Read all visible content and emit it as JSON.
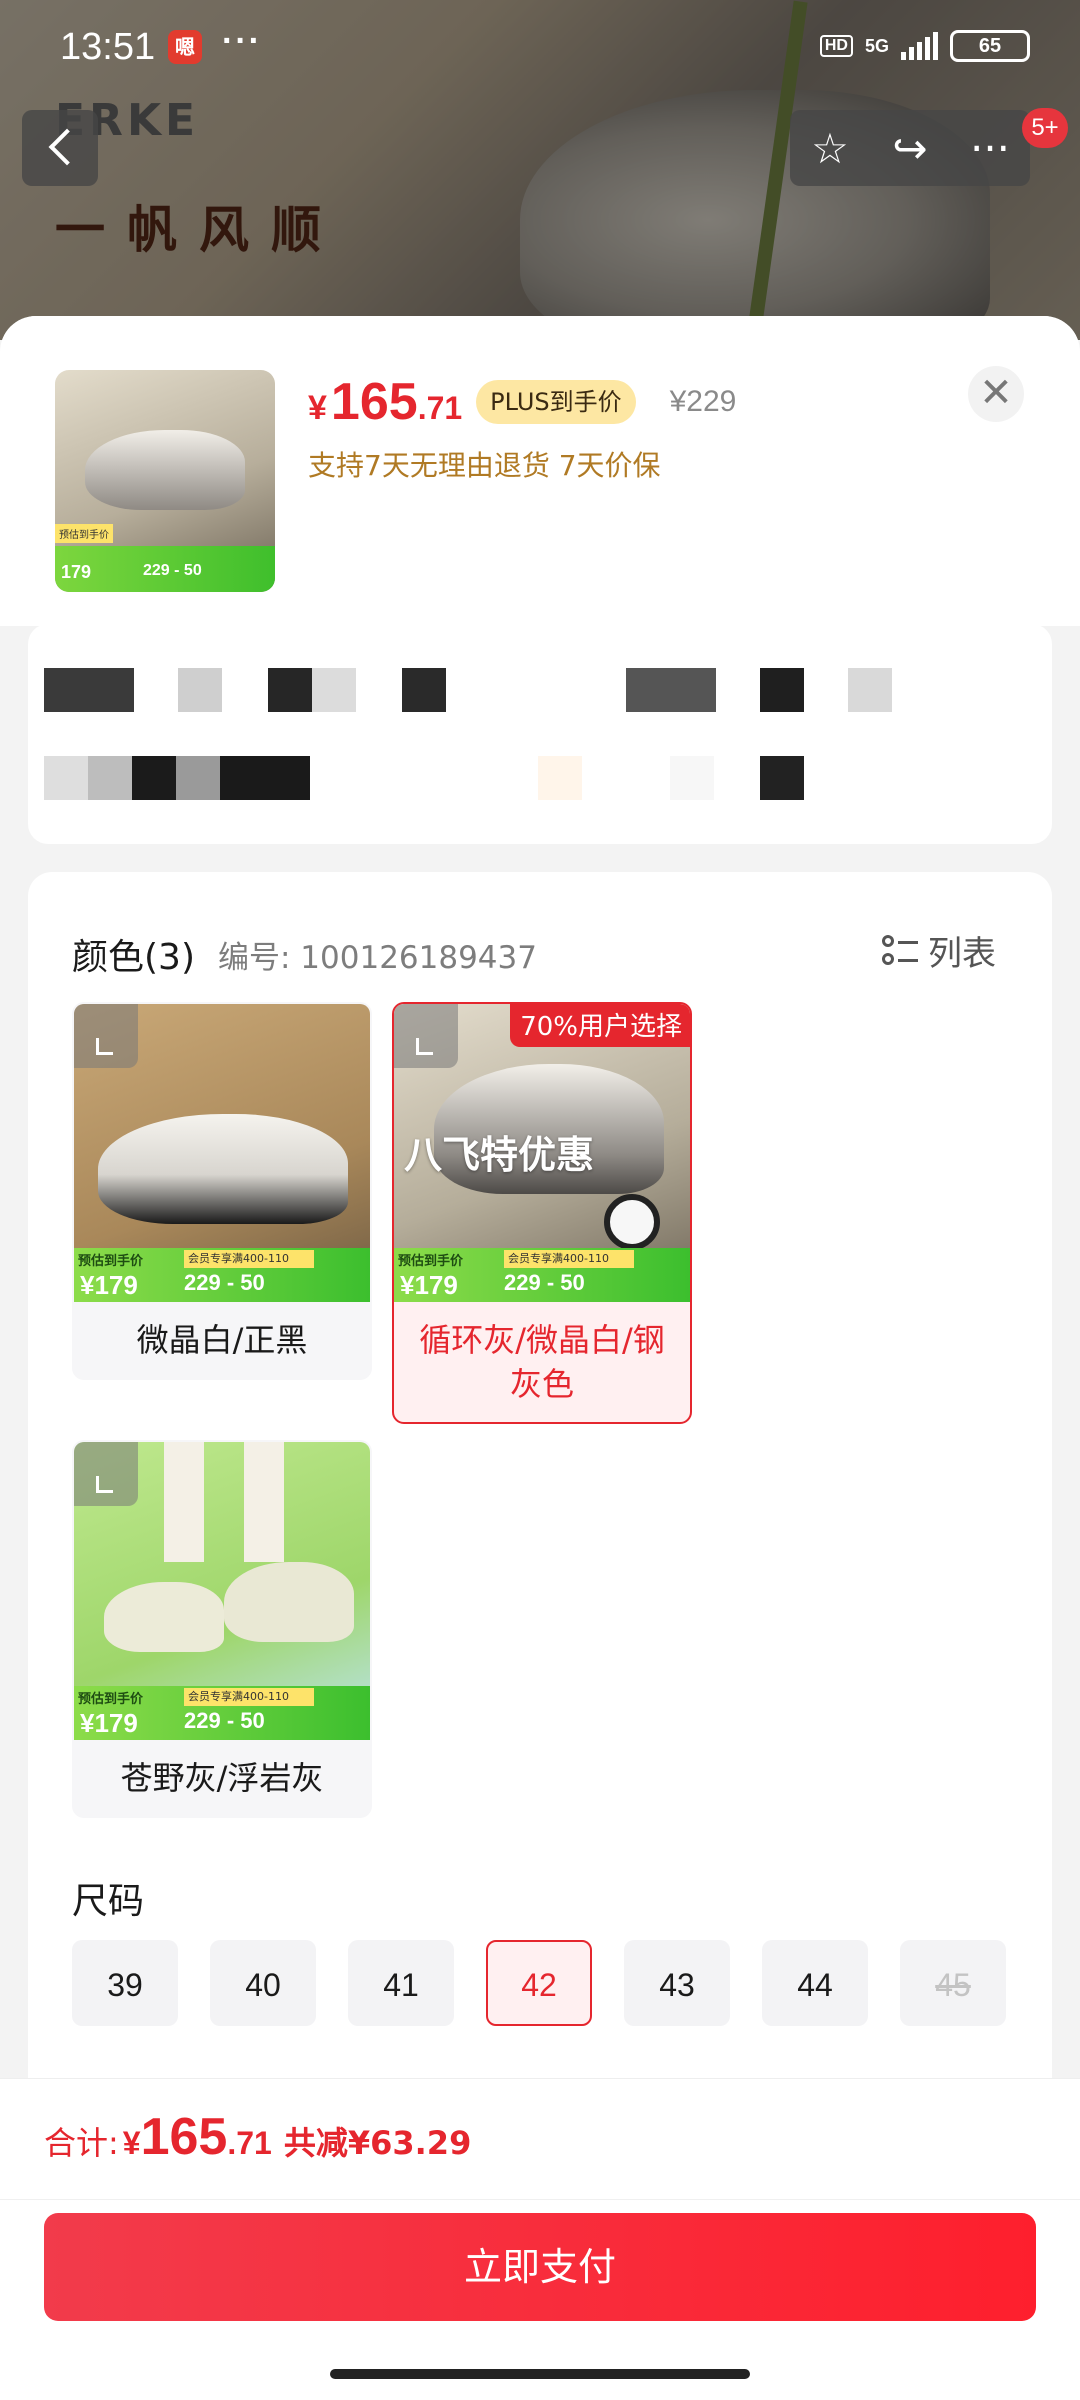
{
  "status_bar": {
    "time": "13:51",
    "app_badge": "嗯",
    "dots": "···",
    "hd": "HD",
    "network": "5G",
    "battery": "65"
  },
  "background": {
    "brand": "ERKE",
    "slogan": "一帆风顺"
  },
  "nav": {
    "badge_count": "5+"
  },
  "product": {
    "currency": "¥",
    "price_int": "165",
    "price_dec": ".71",
    "plus_tag": "PLUS到手价",
    "original_price": "¥229",
    "service_text": "支持7天无理由退货  7天价保",
    "thumb_promo_price": "179",
    "thumb_promo_calc": "229 - 50",
    "thumb_promo_tag": "预估到手价"
  },
  "color_section": {
    "title": "颜色(3)",
    "code": "编号: 100126189437",
    "list_label": "列表",
    "options": [
      {
        "label": "微晶白/正黑",
        "selected": false,
        "badge": "",
        "overlay": ""
      },
      {
        "label": "循环灰/微晶白/钢灰色",
        "selected": true,
        "badge": "70%用户选择",
        "overlay": "八飞特优惠"
      },
      {
        "label": "苍野灰/浮岩灰",
        "selected": false,
        "badge": "",
        "overlay": ""
      }
    ],
    "promo_strip": {
      "tag": "预估到手价",
      "price": "¥179",
      "calc": "229 - 50",
      "coupon": "会员专享满400-110"
    }
  },
  "size_section": {
    "title": "尺码",
    "sizes": [
      {
        "label": "39",
        "state": "normal"
      },
      {
        "label": "40",
        "state": "normal"
      },
      {
        "label": "41",
        "state": "normal"
      },
      {
        "label": "42",
        "state": "selected"
      },
      {
        "label": "43",
        "state": "normal"
      },
      {
        "label": "44",
        "state": "normal"
      },
      {
        "label": "45",
        "state": "disabled"
      }
    ]
  },
  "footer": {
    "total_label": "合计:",
    "currency": "¥",
    "total_int": "165",
    "total_dec": ".71",
    "discount": "共减¥63.29",
    "pay_button": "立即支付"
  },
  "colors": {
    "accent_red": "#e5262e",
    "service_gold": "#b07a24",
    "promo_green": "#3fbf2c"
  }
}
